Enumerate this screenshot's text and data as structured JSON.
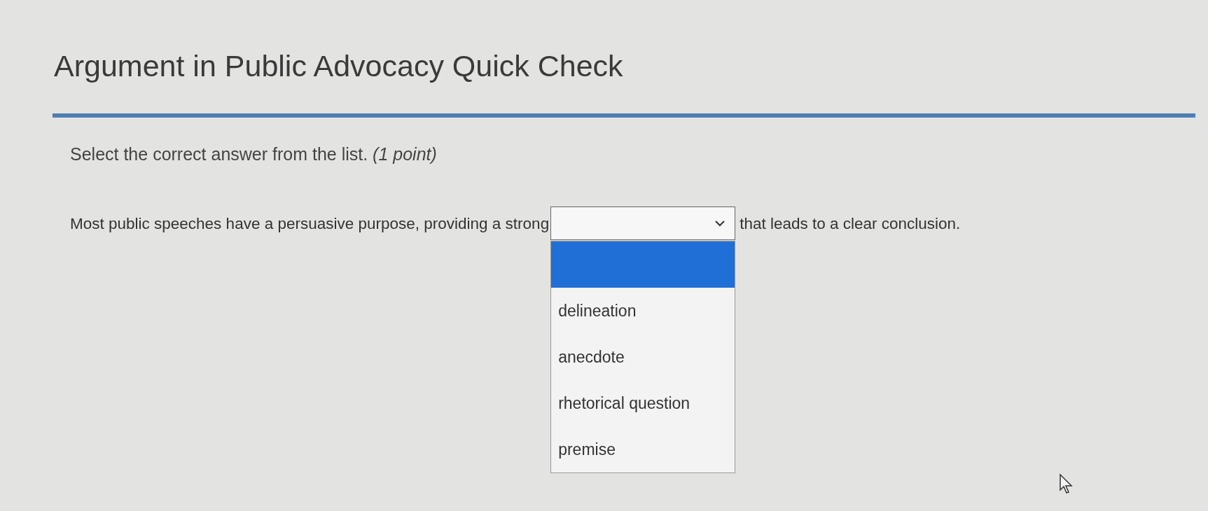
{
  "title": "Argument in Public Advocacy Quick Check",
  "instruction": "Select the correct answer from the list. *(1 point)*",
  "question": {
    "before": "Most public speeches have a persuasive purpose, providing a strong",
    "after": "that leads to a clear conclusion.",
    "dropdown": {
      "expanded": true,
      "blank_option": {
        "selected": true
      },
      "options": [
        {
          "label": "delineation",
          "selected": false
        },
        {
          "label": "anecdote",
          "selected": false
        },
        {
          "label": "rhetorical question",
          "selected": false
        },
        {
          "label": "premise",
          "selected": false
        }
      ]
    }
  }
}
